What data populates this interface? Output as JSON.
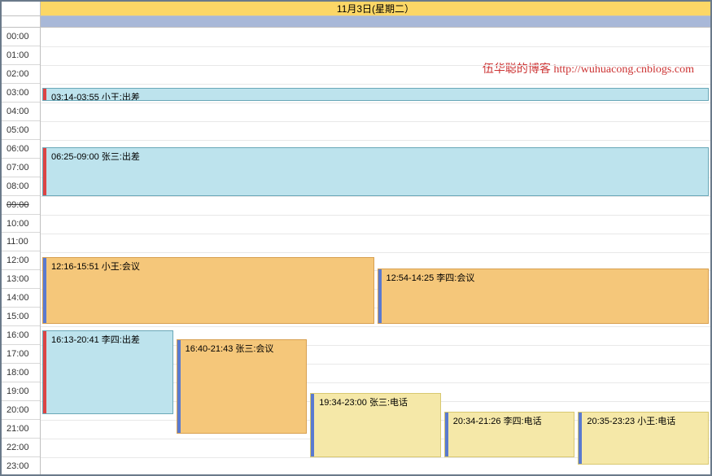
{
  "header": {
    "date_label": "11月3日(星期二）"
  },
  "watermark": "伍华聪的博客 http://wuhuacong.cnblogs.com",
  "hours": [
    "00:00",
    "01:00",
    "02:00",
    "03:00",
    "04:00",
    "05:00",
    "06:00",
    "07:00",
    "08:00",
    "09:00",
    "10:00",
    "11:00",
    "12:00",
    "13:00",
    "14:00",
    "15:00",
    "16:00",
    "17:00",
    "18:00",
    "19:00",
    "20:00",
    "21:00",
    "22:00",
    "23:00"
  ],
  "strike_hour_index": 9,
  "events": [
    {
      "label": "03:14-03:55 小王:出差",
      "start": 3.23,
      "end": 3.92,
      "col": 0,
      "cols": 1,
      "style": "blue"
    },
    {
      "label": "06:25-09:00 张三:出差",
      "start": 6.42,
      "end": 9.0,
      "col": 0,
      "cols": 1,
      "style": "blue"
    },
    {
      "label": "12:16-15:51 小王:会议",
      "start": 12.27,
      "end": 15.85,
      "col": 0,
      "cols": 2,
      "style": "orange"
    },
    {
      "label": "12:54-14:25 李四:会议",
      "start": 12.9,
      "end": 15.85,
      "col": 1,
      "cols": 2,
      "style": "orange"
    },
    {
      "label": "16:13-20:41 李四:出差",
      "start": 16.22,
      "end": 20.68,
      "col": 0,
      "cols": 5,
      "style": "blue"
    },
    {
      "label": "16:40-21:43 张三:会议",
      "start": 16.67,
      "end": 21.72,
      "col": 1,
      "cols": 5,
      "style": "orange"
    },
    {
      "label": "19:34-23:00 张三:电话",
      "start": 19.57,
      "end": 23.0,
      "col": 2,
      "cols": 5,
      "style": "yellow"
    },
    {
      "label": "20:34-21:26 李四:电话",
      "start": 20.57,
      "end": 23.0,
      "col": 3,
      "cols": 5,
      "style": "yellow"
    },
    {
      "label": "20:35-23:23 小王:电话",
      "start": 20.58,
      "end": 23.38,
      "col": 4,
      "cols": 5,
      "style": "yellow"
    }
  ],
  "colors": {
    "blue_bg": "#bde3ed",
    "orange_bg": "#f5c77a",
    "yellow_bg": "#f5e8a8"
  }
}
